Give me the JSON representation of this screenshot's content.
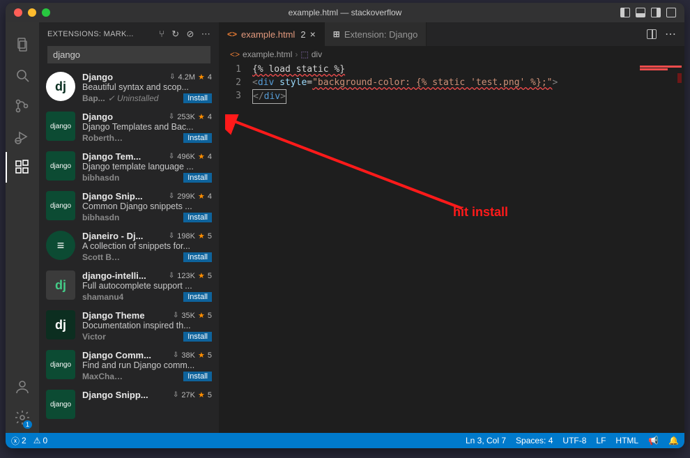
{
  "window": {
    "title": "example.html — stackoverflow"
  },
  "sidebar": {
    "header_label": "EXTENSIONS: MARK...",
    "search_value": "django"
  },
  "extensions": [
    {
      "name": "Django",
      "downloads": "4.2M",
      "rating": "4",
      "desc": "Beautiful syntax and scop...",
      "publisher": "Bap...",
      "uninstalled": "Uninstalled",
      "install": "Install",
      "icon_bg": "#ffffff",
      "icon_fg": "#092e20",
      "icon_text": "dj",
      "circle": true
    },
    {
      "name": "Django",
      "downloads": "253K",
      "rating": "4",
      "desc": "Django Templates and Bac...",
      "publisher": "Roberth Solis",
      "install": "Install",
      "icon_bg": "#0c4b33",
      "icon_fg": "#fff",
      "icon_text": "django",
      "small": true
    },
    {
      "name": "Django Tem...",
      "downloads": "496K",
      "rating": "4",
      "desc": "Django template language ...",
      "publisher": "bibhasdn",
      "install": "Install",
      "icon_bg": "#0c4b33",
      "icon_fg": "#fff",
      "icon_text": "django",
      "small": true
    },
    {
      "name": "Django Snip...",
      "downloads": "299K",
      "rating": "4",
      "desc": "Common Django snippets ...",
      "publisher": "bibhasdn",
      "install": "Install",
      "icon_bg": "#0c4b33",
      "icon_fg": "#fff",
      "icon_text": "django",
      "small": true
    },
    {
      "name": "Djaneiro - Dj...",
      "downloads": "198K",
      "rating": "5",
      "desc": "A collection of snippets for...",
      "publisher": "Scott Barkman",
      "install": "Install",
      "icon_bg": "#0c4b33",
      "icon_fg": "#fff",
      "icon_text": "≡",
      "circle": true
    },
    {
      "name": "django-intelli...",
      "downloads": "123K",
      "rating": "5",
      "desc": "Full autocomplete support ...",
      "publisher": "shamanu4",
      "install": "Install",
      "icon_bg": "#3b3b3b",
      "icon_fg": "#4c8",
      "icon_text": "dj"
    },
    {
      "name": "Django Theme",
      "downloads": "35K",
      "rating": "5",
      "desc": "Documentation inspired th...",
      "publisher": "Victor",
      "install": "Install",
      "icon_bg": "#0c2e20",
      "icon_fg": "#fff",
      "icon_text": "dj"
    },
    {
      "name": "Django Comm...",
      "downloads": "38K",
      "rating": "5",
      "desc": "Find and run Django comm...",
      "publisher": "MaxChamps",
      "install": "Install",
      "icon_bg": "#0c4b33",
      "icon_fg": "#fff",
      "icon_text": "django",
      "small": true
    },
    {
      "name": "Django Snipp...",
      "downloads": "27K",
      "rating": "5",
      "desc": "",
      "publisher": "",
      "install": "",
      "icon_bg": "#0c4b33",
      "icon_fg": "#fff",
      "icon_text": "django",
      "small": true
    }
  ],
  "tabs": {
    "active": {
      "name": "example.html",
      "modified": "2"
    },
    "inactive": {
      "name": "Extension: Django"
    }
  },
  "breadcrumbs": {
    "file_icon": "<>",
    "file": "example.html",
    "node_icon": "⬚",
    "node": "div"
  },
  "code": {
    "lines": [
      "1",
      "2",
      "3"
    ],
    "line1": "{% load static %}",
    "line2_pre": "<",
    "line2_tag": "div",
    "line2_sp": " ",
    "line2_attr": "style",
    "line2_eq": "=",
    "line2_str": "\"background-color: {% static 'test.png' %};\"",
    "line2_close": ">",
    "line3_open": "<",
    "line3_slash": "/",
    "line3_tag": "div",
    "line3_close": ">"
  },
  "annotation": "hit install",
  "statusbar": {
    "errors": "2",
    "warnings": "0",
    "lncol": "Ln 3, Col 7",
    "spaces": "Spaces: 4",
    "encoding": "UTF-8",
    "eol": "LF",
    "lang": "HTML"
  },
  "settings_badge": "1"
}
